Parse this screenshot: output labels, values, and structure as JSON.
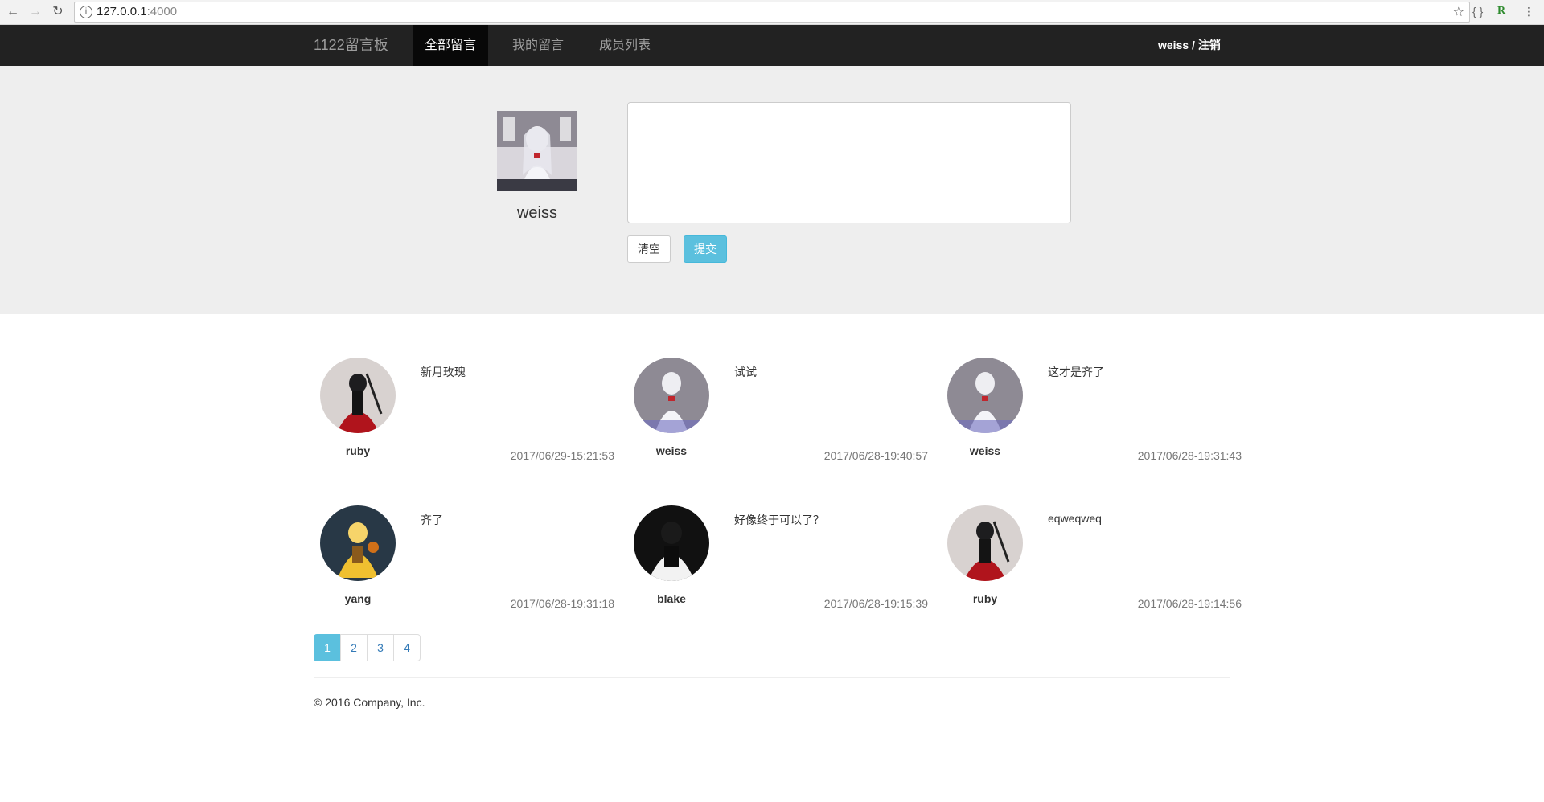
{
  "browser": {
    "url_host": "127.0.0.1",
    "url_port": ":4000",
    "info_icon": "info-icon",
    "star_icon": "star-icon"
  },
  "navbar": {
    "brand": "1122留言板",
    "items": [
      {
        "label": "全部留言",
        "active": true
      },
      {
        "label": "我的留言",
        "active": false
      },
      {
        "label": "成员列表",
        "active": false
      }
    ],
    "user_link": "weiss / 注销"
  },
  "compose": {
    "username": "weiss",
    "textarea_value": "",
    "clear_label": "清空",
    "submit_label": "提交"
  },
  "messages": [
    {
      "user": "ruby",
      "avatar": "ruby",
      "text": "新月玫瑰",
      "time": "2017/06/29-15:21:53"
    },
    {
      "user": "weiss",
      "avatar": "weiss",
      "text": "试试",
      "time": "2017/06/28-19:40:57"
    },
    {
      "user": "weiss",
      "avatar": "weiss",
      "text": "这才是齐了",
      "time": "2017/06/28-19:31:43"
    },
    {
      "user": "yang",
      "avatar": "yang",
      "text": "齐了",
      "time": "2017/06/28-19:31:18"
    },
    {
      "user": "blake",
      "avatar": "blake",
      "text": "好像终于可以了？",
      "time": "2017/06/28-19:15:39"
    },
    {
      "user": "ruby",
      "avatar": "ruby",
      "text": "eqweqweq",
      "time": "2017/06/28-19:14:56"
    }
  ],
  "pagination": {
    "pages": [
      "1",
      "2",
      "3",
      "4"
    ],
    "current": "1"
  },
  "footer": {
    "copyright": "© 2016 Company, Inc."
  },
  "colors": {
    "navbar_bg": "#222222",
    "accent": "#5bc0de",
    "jumbotron_bg": "#eeeeee"
  }
}
